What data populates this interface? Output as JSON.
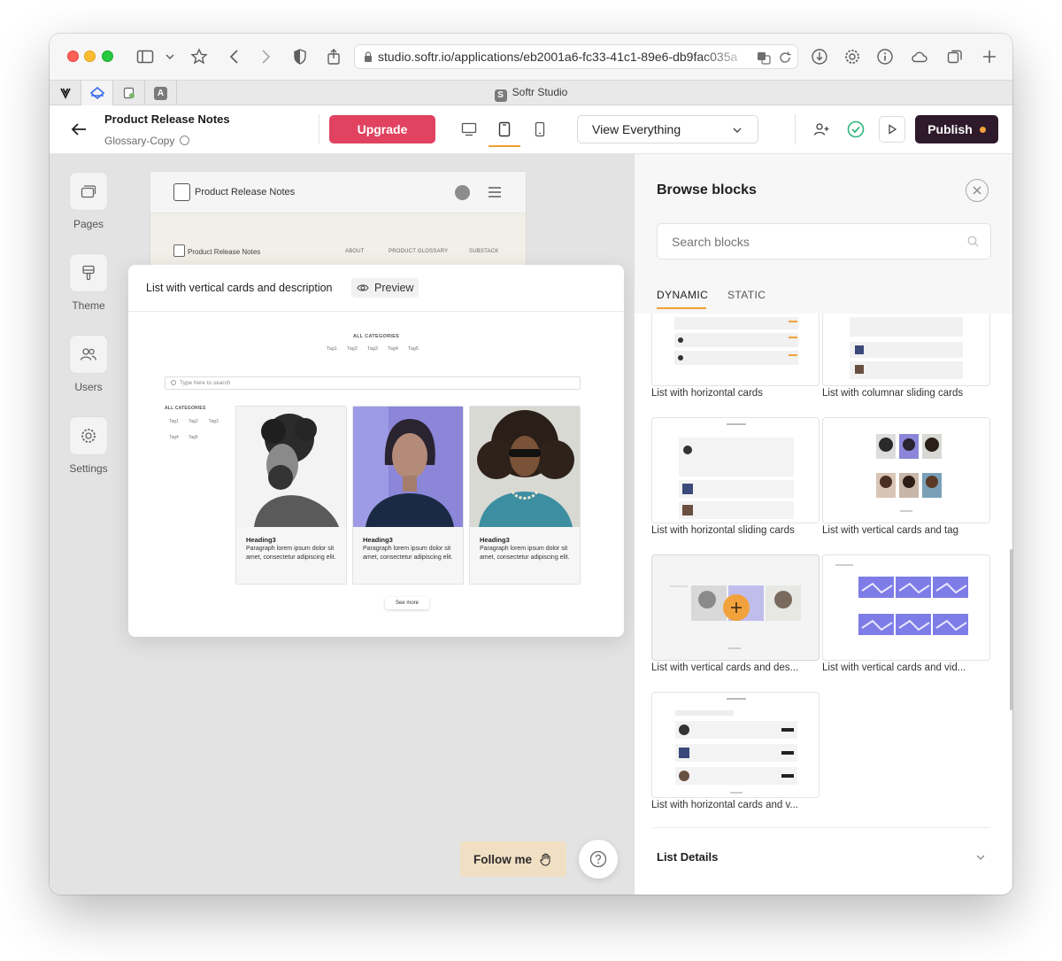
{
  "browser": {
    "url": "studio.softr.io/applications/eb2001a6-fc33-41c1-89e6-db9fac035a",
    "tab_title": "Softr Studio",
    "tab_badge": "S"
  },
  "header": {
    "project_title": "Product Release Notes",
    "project_subtitle": "Glossary-Copy",
    "upgrade_label": "Upgrade",
    "view_select": "View Everything",
    "publish_label": "Publish"
  },
  "sidebar": {
    "items": [
      {
        "label": "Pages",
        "icon": "pages-icon"
      },
      {
        "label": "Theme",
        "icon": "theme-icon"
      },
      {
        "label": "Users",
        "icon": "users-icon"
      },
      {
        "label": "Settings",
        "icon": "settings-icon"
      }
    ]
  },
  "site_preview": {
    "name": "Product Release Notes",
    "name_small": "Product Release Notes",
    "nav": [
      "ABOUT",
      "PRODUCT GLOSSARY",
      "SUBSTACK"
    ]
  },
  "popover": {
    "title": "List with vertical cards and description",
    "preview_label": "Preview",
    "all_categories": "ALL CATEGORIES",
    "tags": [
      "Tag1",
      "Tag2",
      "Tag3",
      "Tag4",
      "Tag5"
    ],
    "search_placeholder": "Type here to search",
    "left_all_categories": "ALL CATEGORIES",
    "cards": [
      {
        "heading": "Heading3",
        "body": "Paragraph lorem ipsum dolor sit amet, consectetur adipiscing elit."
      },
      {
        "heading": "Heading3",
        "body": "Paragraph lorem ipsum dolor sit amet, consectetur adipiscing elit."
      },
      {
        "heading": "Heading3",
        "body": "Paragraph lorem ipsum dolor sit amet, consectetur adipiscing elit."
      }
    ],
    "see_more": "See more"
  },
  "floating": {
    "follow_label": "Follow me",
    "help_icon": "help-icon"
  },
  "panel": {
    "title": "Browse blocks",
    "search_placeholder": "Search blocks",
    "tabs": [
      "DYNAMIC",
      "STATIC"
    ],
    "blocks": [
      "List with horizontal cards",
      "List with columnar sliding cards",
      "List with horizontal sliding cards",
      "List with vertical cards and tag",
      "List with vertical cards and des...",
      "List with vertical cards and vid...",
      "List with horizontal cards and v..."
    ],
    "details_title": "List Details"
  },
  "colors": {
    "upgrade": "#e0425f",
    "publish": "#2e1a2a",
    "accent": "#f0a038",
    "follow_bg": "#f1dfc3"
  }
}
